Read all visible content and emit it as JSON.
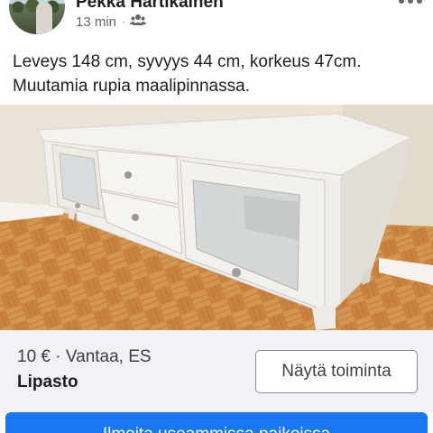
{
  "post": {
    "author": "Pekka Hartikainen",
    "time": "13 min",
    "separator": "·",
    "audience_icon": "group-icon",
    "more_icon": "more-dots-icon",
    "text_line1": "Leveys 148 cm, syvyys 44 cm, korkeus 47cm.",
    "text_line2": "Muutamia rupia maalipinnassa."
  },
  "listing": {
    "price_location": "10 € · Vantaa, ES",
    "title": "Lipasto",
    "action_label": "Näytä toiminta"
  },
  "cta": {
    "label": "Ilmoita useammissa paikoissa"
  },
  "colors": {
    "accent": "#1877f2",
    "listing_bg": "#f0f2f5",
    "secondary_text": "#65676b"
  }
}
